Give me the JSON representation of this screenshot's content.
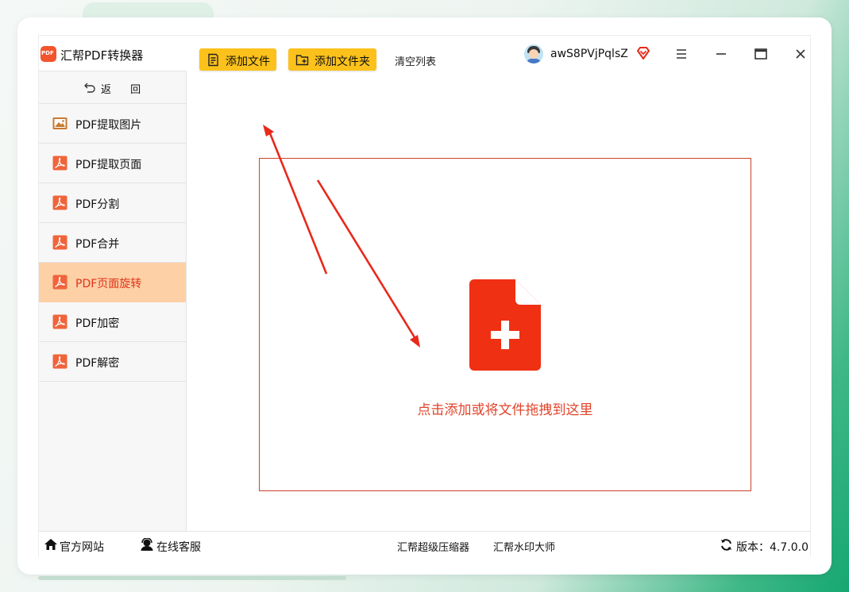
{
  "app": {
    "title": "汇帮PDF转换器",
    "logo_text": "PDF",
    "username": "awS8PVjPqlsZ"
  },
  "sidebar": {
    "back_label": "返 回",
    "items": [
      {
        "label": "PDF提取图片",
        "icon": "image-icon",
        "active": false
      },
      {
        "label": "PDF提取页面",
        "icon": "pdf-icon",
        "active": false
      },
      {
        "label": "PDF分割",
        "icon": "pdf-icon",
        "active": false
      },
      {
        "label": "PDF合并",
        "icon": "pdf-icon",
        "active": false
      },
      {
        "label": "PDF页面旋转",
        "icon": "pdf-icon",
        "active": true
      },
      {
        "label": "PDF加密",
        "icon": "pdf-icon",
        "active": false
      },
      {
        "label": "PDF解密",
        "icon": "pdf-icon",
        "active": false
      }
    ]
  },
  "toolbar": {
    "add_file_label": "添加文件",
    "add_folder_label": "添加文件夹",
    "clear_list_label": "清空列表"
  },
  "dropzone": {
    "hint": "点击添加或将文件拖拽到这里"
  },
  "footer": {
    "website_label": "官方网站",
    "support_label": "在线客服",
    "compressor_label": "汇帮超级压缩器",
    "watermark_label": "汇帮水印大师",
    "version_label": "版本：4.7.0.0"
  },
  "colors": {
    "accent_yellow": "#fcc21b",
    "active_item_bg": "#fdd0a6",
    "brand_red": "#f2542d",
    "drop_border": "#c9432a",
    "annotation_arrow": "#e8291b"
  }
}
